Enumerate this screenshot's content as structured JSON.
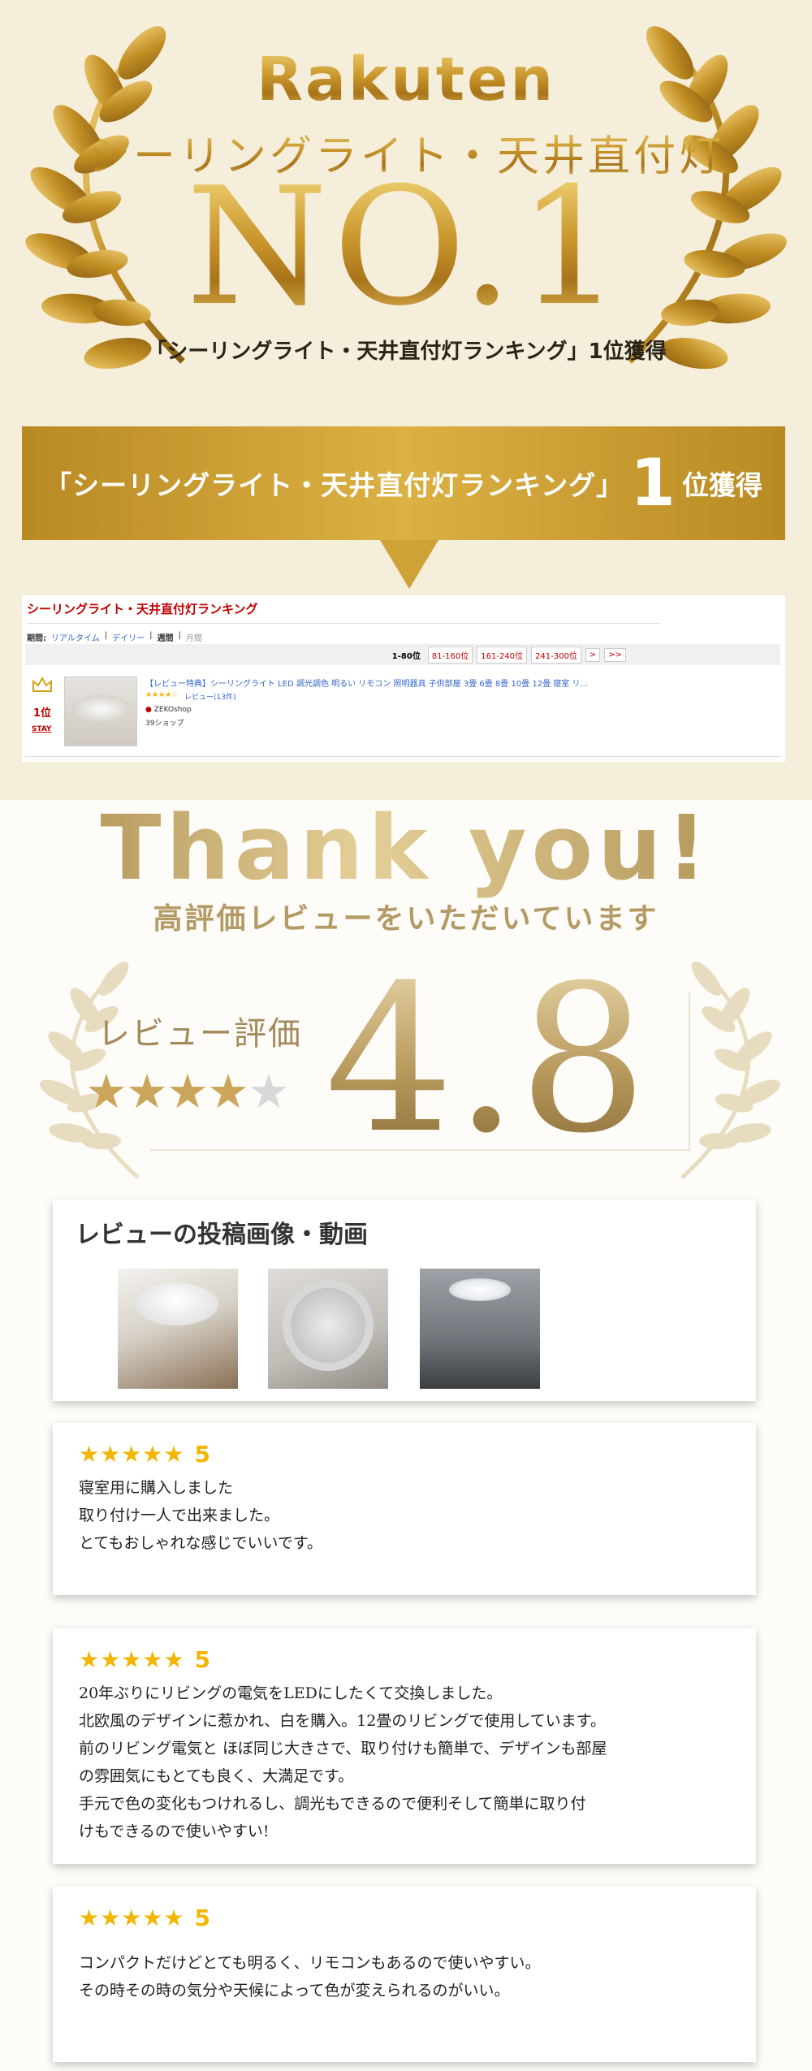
{
  "hero": {
    "brand": "Rakuten",
    "category": "シーリングライト・天井直付灯",
    "rank_big": "NO.1",
    "caption": "「シーリングライト・天井直付灯ランキング」1位獲得"
  },
  "banner": {
    "prefix": "「シーリングライト・天井直付灯ランキング」",
    "number": "1",
    "suffix": "位獲得"
  },
  "ranking": {
    "title": "シーリングライト・天井直付灯ランキング",
    "period_label": "期間:",
    "periods": [
      "リアルタイム",
      "デイリー",
      "週間",
      "月間"
    ],
    "pages": [
      "1-80位",
      "81-160位",
      "161-240位",
      "241-300位",
      ">",
      ">>"
    ],
    "rank": "1位",
    "stay": "STAY",
    "product_name": "【レビュー特典】シーリングライト LED 調光調色 明るい リモコン 照明器具 子供部屋 3畳 6畳 8畳 10畳 12畳 寝室 リ...",
    "stars": "★★★★☆",
    "reviews": "レビュー(13件)",
    "shop": "ZEKOshop",
    "shipping": "39ショップ"
  },
  "thanks": {
    "title": "Thank you!",
    "subtitle": "高評価レビューをいただいています",
    "rating_label": "レビュー評価",
    "rating": "4.8",
    "stars_full": "★★★★",
    "stars_empty": "★",
    "colors": {
      "gold": "#caa55a",
      "star_yellow": "#f2b600",
      "banner_gold": "#cfa238"
    }
  },
  "photos": {
    "title": "レビューの投稿画像・動画"
  },
  "reviews": [
    {
      "stars": "★★★★★",
      "score": "5",
      "text": "寝室用に購入しました\n取り付け一人で出来ました。\nとてもおしゃれな感じでいいです。"
    },
    {
      "stars": "★★★★★",
      "score": "5",
      "text": "20年ぶりにリビングの電気をLEDにしたくて交換しました。\n北欧風のデザインに惹かれ、白を購入。12畳のリビングで使用しています。\n前のリビング電気と ほぼ同じ大きさで、取り付けも簡単で、デザインも部屋\nの雰囲気にもとても良く、大満足です。\n手元で色の変化もつけれるし、調光もできるので便利そして簡単に取り付\nけもできるので使いやすい!"
    },
    {
      "stars": "★★★★★",
      "score": "5",
      "text": "コンパクトだけどとても明るく、リモコンもあるので使いやすい。\nその時その時の気分や天候によって色が変えられるのがいい。"
    }
  ]
}
